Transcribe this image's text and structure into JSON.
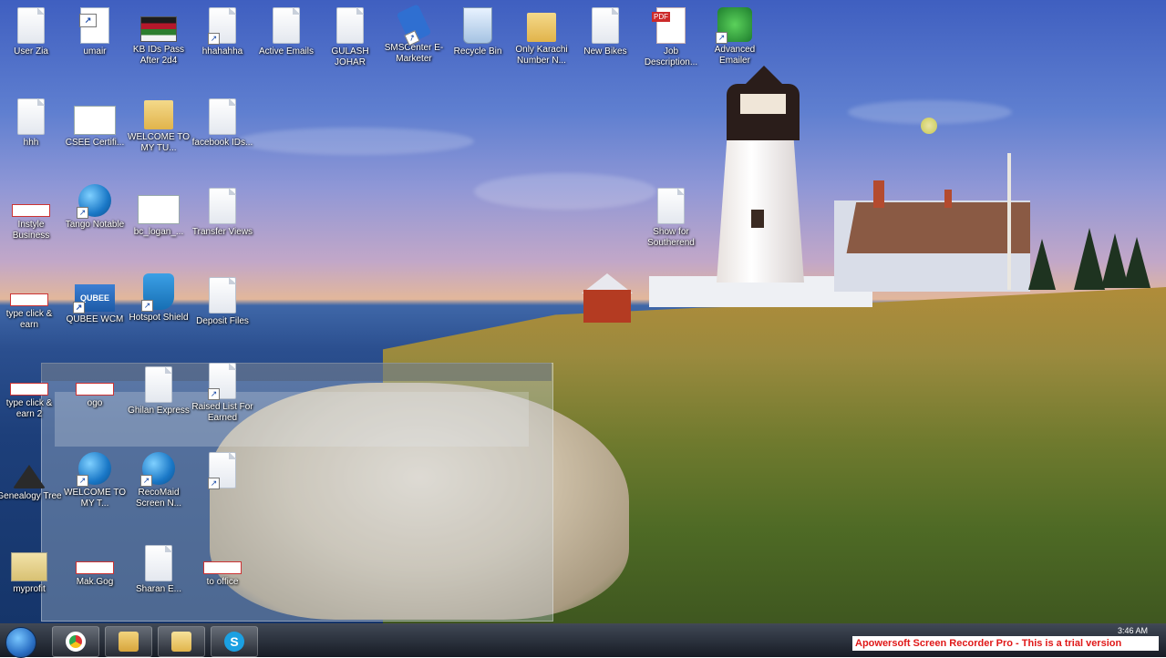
{
  "desktop_icons": [
    {
      "label": "User Zia"
    },
    {
      "label": "umair"
    },
    {
      "label": "KB IDs Pass After 2d4"
    },
    {
      "label": "hhahahha"
    },
    {
      "label": "Active Emails"
    },
    {
      "label": "GULASH JOHAR"
    },
    {
      "label": "SMSCenter E-Marketer"
    },
    {
      "label": "Recycle Bin"
    },
    {
      "label": "Only Karachi Number N..."
    },
    {
      "label": "New Bikes"
    },
    {
      "label": "Job Description..."
    },
    {
      "label": "Advanced Emailer"
    },
    {
      "label": "hhh"
    },
    {
      "label": "CSEE Certifi..."
    },
    {
      "label": "WELCOME TO MY TU..."
    },
    {
      "label": "facebook IDs..."
    },
    {
      "label": "Instyle Business"
    },
    {
      "label": "Tango Notable"
    },
    {
      "label": "bc_logan_..."
    },
    {
      "label": "Transfer Views"
    },
    {
      "label": "Show for Southerend"
    },
    {
      "label": "type click & earn"
    },
    {
      "label": "QUBEE WCM"
    },
    {
      "label": "Hotspot Shield"
    },
    {
      "label": "Deposit Files"
    },
    {
      "label": "type click & earn 2"
    },
    {
      "label": "ogo"
    },
    {
      "label": "Ghilan Express"
    },
    {
      "label": "Raised List For Earned"
    },
    {
      "label": "Genealogy Tree"
    },
    {
      "label": "WELCOME TO MY T..."
    },
    {
      "label": "RecoMaid Screen N..."
    },
    {
      "label": ""
    },
    {
      "label": "myprofit"
    },
    {
      "label": "Mak.Gog"
    },
    {
      "label": "Sharan E..."
    },
    {
      "label": "to office"
    }
  ],
  "taskbar": {
    "clock_time": "3:46 AM",
    "pinned": [
      "Google Chrome",
      "Windows Explorer",
      "Folder",
      "Skype"
    ]
  },
  "watermark": {
    "text": "Apowersoft Screen Recorder Pro - This is a trial version",
    "color": "#e01818"
  },
  "colors": {
    "taskbar": "#0f1826",
    "icon_label": "#ffffff"
  }
}
